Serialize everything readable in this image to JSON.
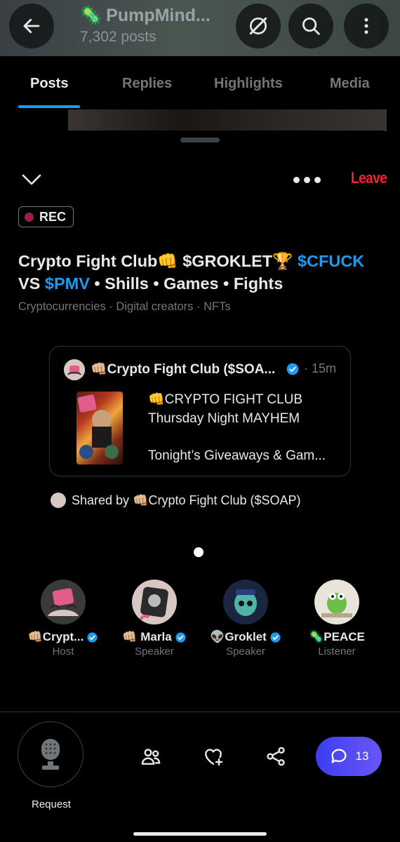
{
  "header": {
    "title": "PumpMind...",
    "posts_count": "7,302 posts"
  },
  "tabs": [
    "Posts",
    "Replies",
    "Highlights",
    "Media"
  ],
  "space": {
    "leave_label": "Leave",
    "rec_label": "REC",
    "title_part1": "Crypto Fight Club👊 $GROKLET🏆 ",
    "title_cash1": "$CFUCK",
    "title_part2": "VS ",
    "title_cash2": "$PMV",
    "title_part3": " • Shills • Games • Fights",
    "topics": "Cryptocurrencies · Digital creators · NFTs"
  },
  "shared_post": {
    "author": "👊🏼Crypto Fight Club ($SOA...",
    "time": "· 15m",
    "line1": "👊CRYPTO FIGHT CLUB",
    "line2": "Thursday Night MAYHEM",
    "line3": "Tonight’s Giveaways & Gam..."
  },
  "shared_by": "Shared by 👊🏼Crypto Fight Club ($SOAP)",
  "participants": [
    {
      "name": "👊🏼Crypt...",
      "role": "Host",
      "verified": true
    },
    {
      "name": "👊🏼 Marla",
      "role": "Speaker",
      "verified": true
    },
    {
      "name": "👽Groklet",
      "role": "Speaker",
      "verified": true
    },
    {
      "name": "🦠PEACE",
      "role": "Listener",
      "verified": false
    }
  ],
  "controls": {
    "request_label": "Request",
    "chat_count": "13"
  },
  "colors": {
    "accent": "#1d9bf0",
    "leave": "#f4212e",
    "rec_dot": "#9d1b4e",
    "chat_pill": "#5a4cf4"
  }
}
